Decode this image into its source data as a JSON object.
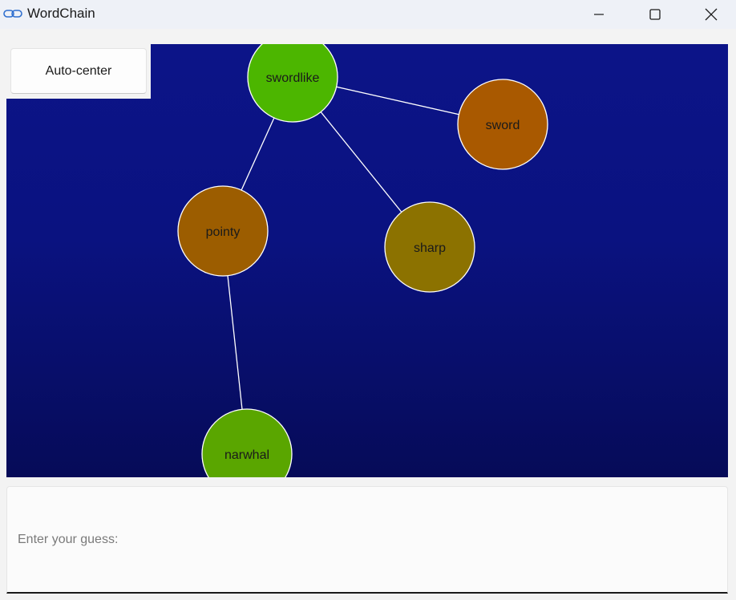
{
  "window": {
    "title": "WordChain",
    "controls": {
      "minimize_icon": "minimize-icon",
      "maximize_icon": "maximize-icon",
      "close_icon": "close-icon"
    }
  },
  "toolbar": {
    "auto_center_label": "Auto-center"
  },
  "graph": {
    "background_colors": [
      "#0c1488",
      "#060b58"
    ],
    "edge_color": "#ffffff",
    "nodes": [
      {
        "id": "swordlike",
        "label": "swordlike",
        "color": "#4cb600"
      },
      {
        "id": "sword",
        "label": "sword",
        "color": "#a95900"
      },
      {
        "id": "pointy",
        "label": "pointy",
        "color": "#9c5d00"
      },
      {
        "id": "sharp",
        "label": "sharp",
        "color": "#8c7200"
      },
      {
        "id": "narwhal",
        "label": "narwhal",
        "color": "#5aa600"
      }
    ],
    "edges": [
      {
        "from": "swordlike",
        "to": "sword"
      },
      {
        "from": "swordlike",
        "to": "pointy"
      },
      {
        "from": "swordlike",
        "to": "sharp"
      },
      {
        "from": "pointy",
        "to": "narwhal"
      }
    ]
  },
  "guess": {
    "placeholder": "Enter your guess:",
    "value": ""
  }
}
